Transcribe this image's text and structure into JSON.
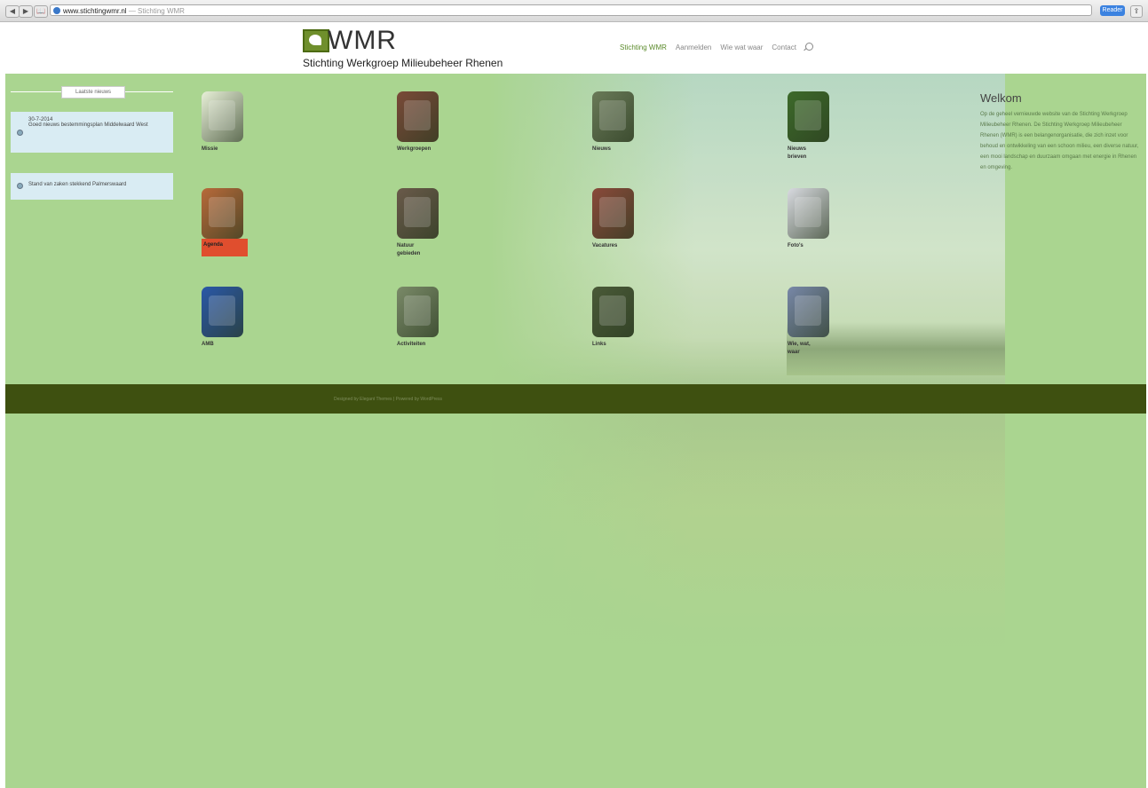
{
  "browser": {
    "back": "◀",
    "forward": "▶",
    "bookmarks": "📖",
    "url": "www.stichtingwmr.nl",
    "page_title": "Stichting WMR",
    "reader_label": "Reader",
    "share_label": "⇪"
  },
  "header": {
    "logo_text": "WMR",
    "logo_subtitle": "Stichting Werkgroep Milieubeheer Rhenen",
    "nav": [
      "Stichting WMR",
      "Aanmelden",
      "Wie wat waar",
      "Contact"
    ]
  },
  "sidebar": {
    "heading": "Laatste nieuws",
    "items": [
      {
        "date": "30-7-2014",
        "text": "Goed nieuws bestemmingsplan Middelwaard West"
      },
      {
        "text": "Stand van zaken stekkend Palmerswaard"
      }
    ]
  },
  "tiles": [
    {
      "label": "Missie",
      "icon": "swallow-icon",
      "color": "#e8f0d8"
    },
    {
      "label": "Werkgroepen",
      "icon": "leaves-icon",
      "color": "#7a4a38"
    },
    {
      "label": "Nieuws",
      "icon": "wood-pile-icon",
      "color": "#6a7a58"
    },
    {
      "label": "Nieuws brieven",
      "icon": "newsletter-icon",
      "color": "#3d6a2a"
    },
    {
      "label": "Agenda",
      "icon": "agenda-icon",
      "color": "#b86a3a"
    },
    {
      "label": "Natuur gebieden",
      "icon": "nature-icon",
      "color": "#6a5a4a"
    },
    {
      "label": "Vacatures",
      "icon": "volunteers-icon",
      "color": "#8a4a3a"
    },
    {
      "label": "Foto's",
      "icon": "photos-icon",
      "color": "#d8dae0"
    },
    {
      "label": "AMB",
      "icon": "amb-icon",
      "color": "#2a58a8"
    },
    {
      "label": "Activiteiten",
      "icon": "church-icon",
      "color": "#7a8a68"
    },
    {
      "label": "Links",
      "icon": "plants-icon",
      "color": "#4a5a38"
    },
    {
      "label": "Wie, wat, waar",
      "icon": "people-icon",
      "color": "#7888a8"
    }
  ],
  "welcome": {
    "title": "Welkom",
    "text": "Op de geheel vernieuwde website van de Stichting Werkgroep Milieubeheer Rhenen. De Stichting Werkgroep Milieubeheer Rhenen (WMR) is een belangenorganisatie, die zich inzet voor behoud en ontwikkeling van een schoon milieu, een diverse natuur, een mooi landschap en duurzaam omgaan met energie in Rhenen en omgeving."
  },
  "footer": {
    "text": "Designed by Elegant Themes | Powered by WordPress"
  }
}
